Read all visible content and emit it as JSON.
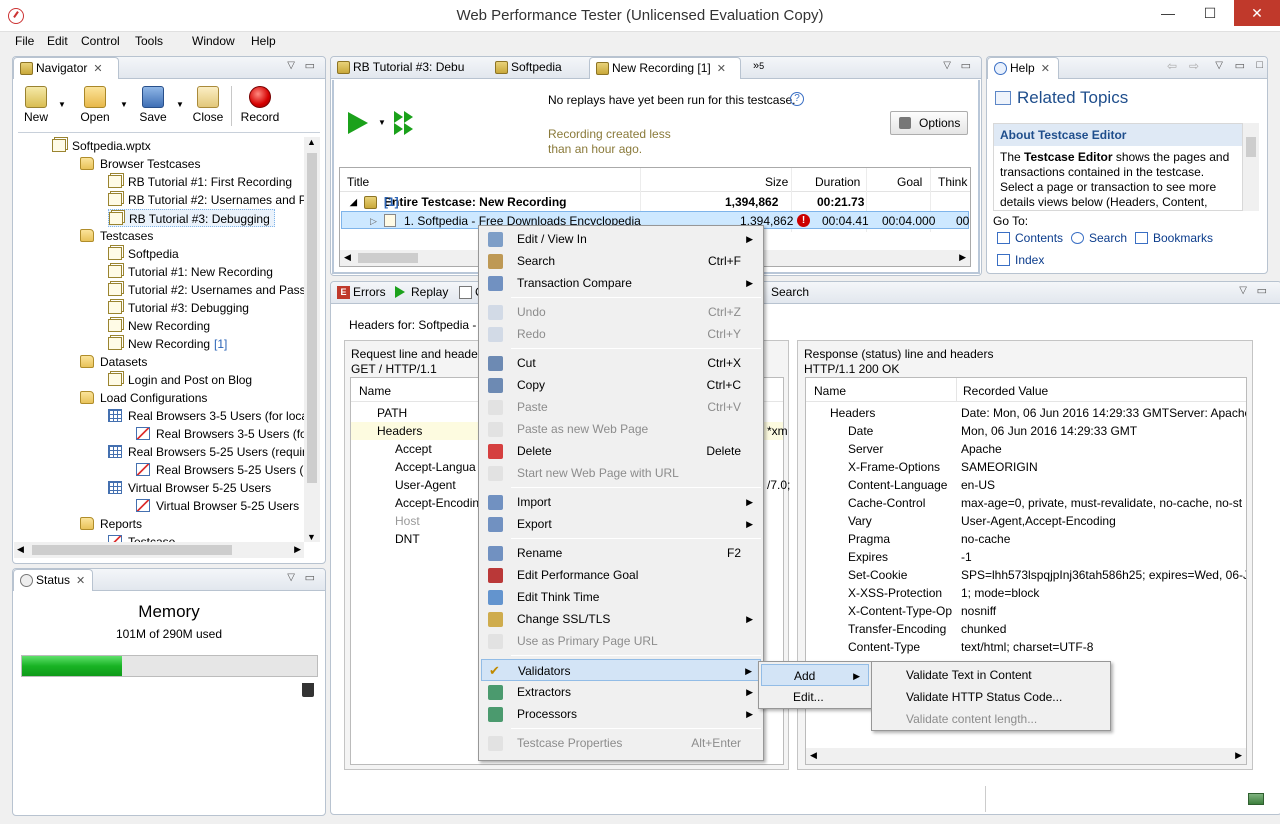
{
  "window": {
    "title": "Web Performance Tester (Unlicensed Evaluation Copy)",
    "min": "—",
    "max": "☐",
    "close": "✕"
  },
  "menubar": [
    "File",
    "Edit",
    "Control",
    "Tools",
    "Window",
    "Help"
  ],
  "navigator": {
    "tab": "Navigator",
    "toolbar": [
      "New",
      "Open",
      "Save",
      "Close",
      "Record"
    ],
    "tree": [
      {
        "label": "Softpedia.wptx",
        "icon": "doc",
        "indent": 0
      },
      {
        "label": "Browser Testcases",
        "icon": "fold",
        "indent": 1
      },
      {
        "label": "RB Tutorial #1: First Recording",
        "icon": "doc",
        "indent": 2
      },
      {
        "label": "RB Tutorial #2: Usernames and P",
        "icon": "doc",
        "indent": 2
      },
      {
        "label": "RB Tutorial #3: Debugging",
        "icon": "doc",
        "indent": 2
      },
      {
        "label": "Testcases",
        "icon": "fold",
        "indent": 1
      },
      {
        "label": "Softpedia",
        "icon": "doc",
        "indent": 2
      },
      {
        "label": "Tutorial #1: New Recording",
        "icon": "doc",
        "indent": 2
      },
      {
        "label": "Tutorial #2: Usernames and Pass",
        "icon": "doc",
        "indent": 2
      },
      {
        "label": "Tutorial #3: Debugging",
        "icon": "doc",
        "indent": 2
      },
      {
        "label": "New Recording",
        "icon": "doc",
        "indent": 2
      },
      {
        "label": "New Recording",
        "suffix": "[1]",
        "icon": "doc",
        "indent": 2
      },
      {
        "label": "Datasets",
        "icon": "fold",
        "indent": 1
      },
      {
        "label": "Login and Post on Blog",
        "icon": "doc",
        "indent": 2
      },
      {
        "label": "Load Configurations",
        "icon": "fold",
        "indent": 1
      },
      {
        "label": "Real Browsers 3-5 Users (for loca",
        "icon": "grid",
        "indent": 2
      },
      {
        "label": "Real Browsers 3-5 Users (fo",
        "icon": "chart",
        "indent": 3
      },
      {
        "label": "Real Browsers 5-25 Users (require",
        "icon": "grid",
        "indent": 2
      },
      {
        "label": "Real Browsers 5-25 Users (r",
        "icon": "chart",
        "indent": 3
      },
      {
        "label": "Virtual Browser 5-25 Users",
        "icon": "grid",
        "indent": 2
      },
      {
        "label": "Virtual Browser 5-25 Users",
        "icon": "chart",
        "indent": 3
      },
      {
        "label": "Reports",
        "icon": "fold",
        "indent": 1
      },
      {
        "label": "Testcase",
        "icon": "chart",
        "indent": 2
      }
    ]
  },
  "status": {
    "tab": "Status",
    "heading": "Memory",
    "used": "101M of 290M used",
    "progress": 0.34
  },
  "editor": {
    "tabs": [
      "RB Tutorial #3: Debu",
      "Softpedia",
      "New Recording [1]"
    ],
    "overflow": "5",
    "message": "No replays have yet been run for this testcase.",
    "recorded": "Recording created less than an hour ago.",
    "options": "Options",
    "columns": [
      "Title",
      "Size",
      "Duration",
      "Goal",
      "Think"
    ],
    "rows": [
      {
        "title": "Entire Testcase: New Recording",
        "suffix": "[1]",
        "size": "1,394,862",
        "duration": "00:21.73",
        "goal": "",
        "think": ""
      },
      {
        "title": "1. Softpedia - Free Downloads Encyclopedia",
        "size": "1,394,862",
        "duration": "00:04.41",
        "goal": "00:04.000",
        "think": "00"
      }
    ]
  },
  "bottom": {
    "tabs": [
      "Errors",
      "Replay",
      "C",
      "Search"
    ],
    "headers_for": "Headers for: Softpedia -",
    "request": {
      "title": "Request line and header",
      "line": "GET / HTTP/1.1",
      "col": "Name",
      "rows": [
        {
          "n": "PATH",
          "v": ""
        },
        {
          "n": "Headers",
          "v": "*xm"
        },
        {
          "n": "Accept",
          "v": ""
        },
        {
          "n": "Accept-Langua",
          "v": ""
        },
        {
          "n": "User-Agent",
          "v": "/7.0;"
        },
        {
          "n": "Accept-Encodin",
          "v": ""
        },
        {
          "n": "Host",
          "v": ""
        },
        {
          "n": "DNT",
          "v": ""
        }
      ]
    },
    "response": {
      "title": "Response (status) line and headers",
      "line": "HTTP/1.1 200 OK",
      "cols": [
        "Name",
        "Recorded Value"
      ],
      "rows": [
        {
          "n": "Headers",
          "v": "Date: Mon, 06 Jun 2016 14:29:33 GMTServer: ApacheX"
        },
        {
          "n": "Date",
          "v": "Mon, 06 Jun 2016 14:29:33 GMT"
        },
        {
          "n": "Server",
          "v": "Apache"
        },
        {
          "n": "X-Frame-Options",
          "v": "SAMEORIGIN"
        },
        {
          "n": "Content-Language",
          "v": "en-US"
        },
        {
          "n": "Cache-Control",
          "v": "max-age=0, private, must-revalidate, no-cache, no-st"
        },
        {
          "n": "Vary",
          "v": "User-Agent,Accept-Encoding"
        },
        {
          "n": "Pragma",
          "v": "no-cache"
        },
        {
          "n": "Expires",
          "v": "-1"
        },
        {
          "n": "Set-Cookie",
          "v": "SPS=lhh573lspqjpInj36tah586h25; expires=Wed, 06-Jul"
        },
        {
          "n": "X-XSS-Protection",
          "v": "1; mode=block"
        },
        {
          "n": "X-Content-Type-Op",
          "v": "nosniff"
        },
        {
          "n": "Transfer-Encoding",
          "v": "chunked"
        },
        {
          "n": "Content-Type",
          "v": "text/html; charset=UTF-8"
        }
      ]
    }
  },
  "help": {
    "tab": "Help",
    "heading": "Related Topics",
    "about": "About Testcase Editor",
    "body_pre": "The ",
    "body_bold": "Testcase Editor",
    "body_post": " shows the pages and transactions contained in the testcase. Select a page or transaction to see more details views below (Headers, Content,",
    "goto": "Go To:",
    "links": [
      "Contents",
      "Search",
      "Bookmarks",
      "Index"
    ]
  },
  "context_menu": [
    {
      "label": "Edit / View In",
      "sub": true
    },
    {
      "label": "Search",
      "key": "Ctrl+F"
    },
    {
      "label": "Transaction Compare",
      "sub": true
    },
    {
      "sep": true
    },
    {
      "label": "Undo",
      "key": "Ctrl+Z",
      "dis": true
    },
    {
      "label": "Redo",
      "key": "Ctrl+Y",
      "dis": true
    },
    {
      "sep": true
    },
    {
      "label": "Cut",
      "key": "Ctrl+X"
    },
    {
      "label": "Copy",
      "key": "Ctrl+C"
    },
    {
      "label": "Paste",
      "key": "Ctrl+V",
      "dis": true
    },
    {
      "label": "Paste as new Web Page",
      "dis": true
    },
    {
      "label": "Delete",
      "key": "Delete"
    },
    {
      "label": "Start new Web Page with URL",
      "dis": true
    },
    {
      "sep": true
    },
    {
      "label": "Import",
      "sub": true
    },
    {
      "label": "Export",
      "sub": true
    },
    {
      "sep": true
    },
    {
      "label": "Rename",
      "key": "F2"
    },
    {
      "label": "Edit Performance Goal"
    },
    {
      "label": "Edit Think Time"
    },
    {
      "label": "Change SSL/TLS",
      "sub": true
    },
    {
      "label": "Use as Primary Page URL",
      "dis": true
    },
    {
      "sep": true
    },
    {
      "label": "Validators",
      "sub": true,
      "hl": true
    },
    {
      "label": "Extractors",
      "sub": true
    },
    {
      "label": "Processors",
      "sub": true
    },
    {
      "sep": true
    },
    {
      "label": "Testcase Properties",
      "key": "Alt+Enter",
      "dis": true
    }
  ],
  "submenu1": [
    "Add",
    "Edit..."
  ],
  "submenu2": [
    {
      "label": "Validate Text in Content"
    },
    {
      "label": "Validate HTTP Status Code..."
    },
    {
      "label": "Validate content length...",
      "dis": true
    }
  ]
}
